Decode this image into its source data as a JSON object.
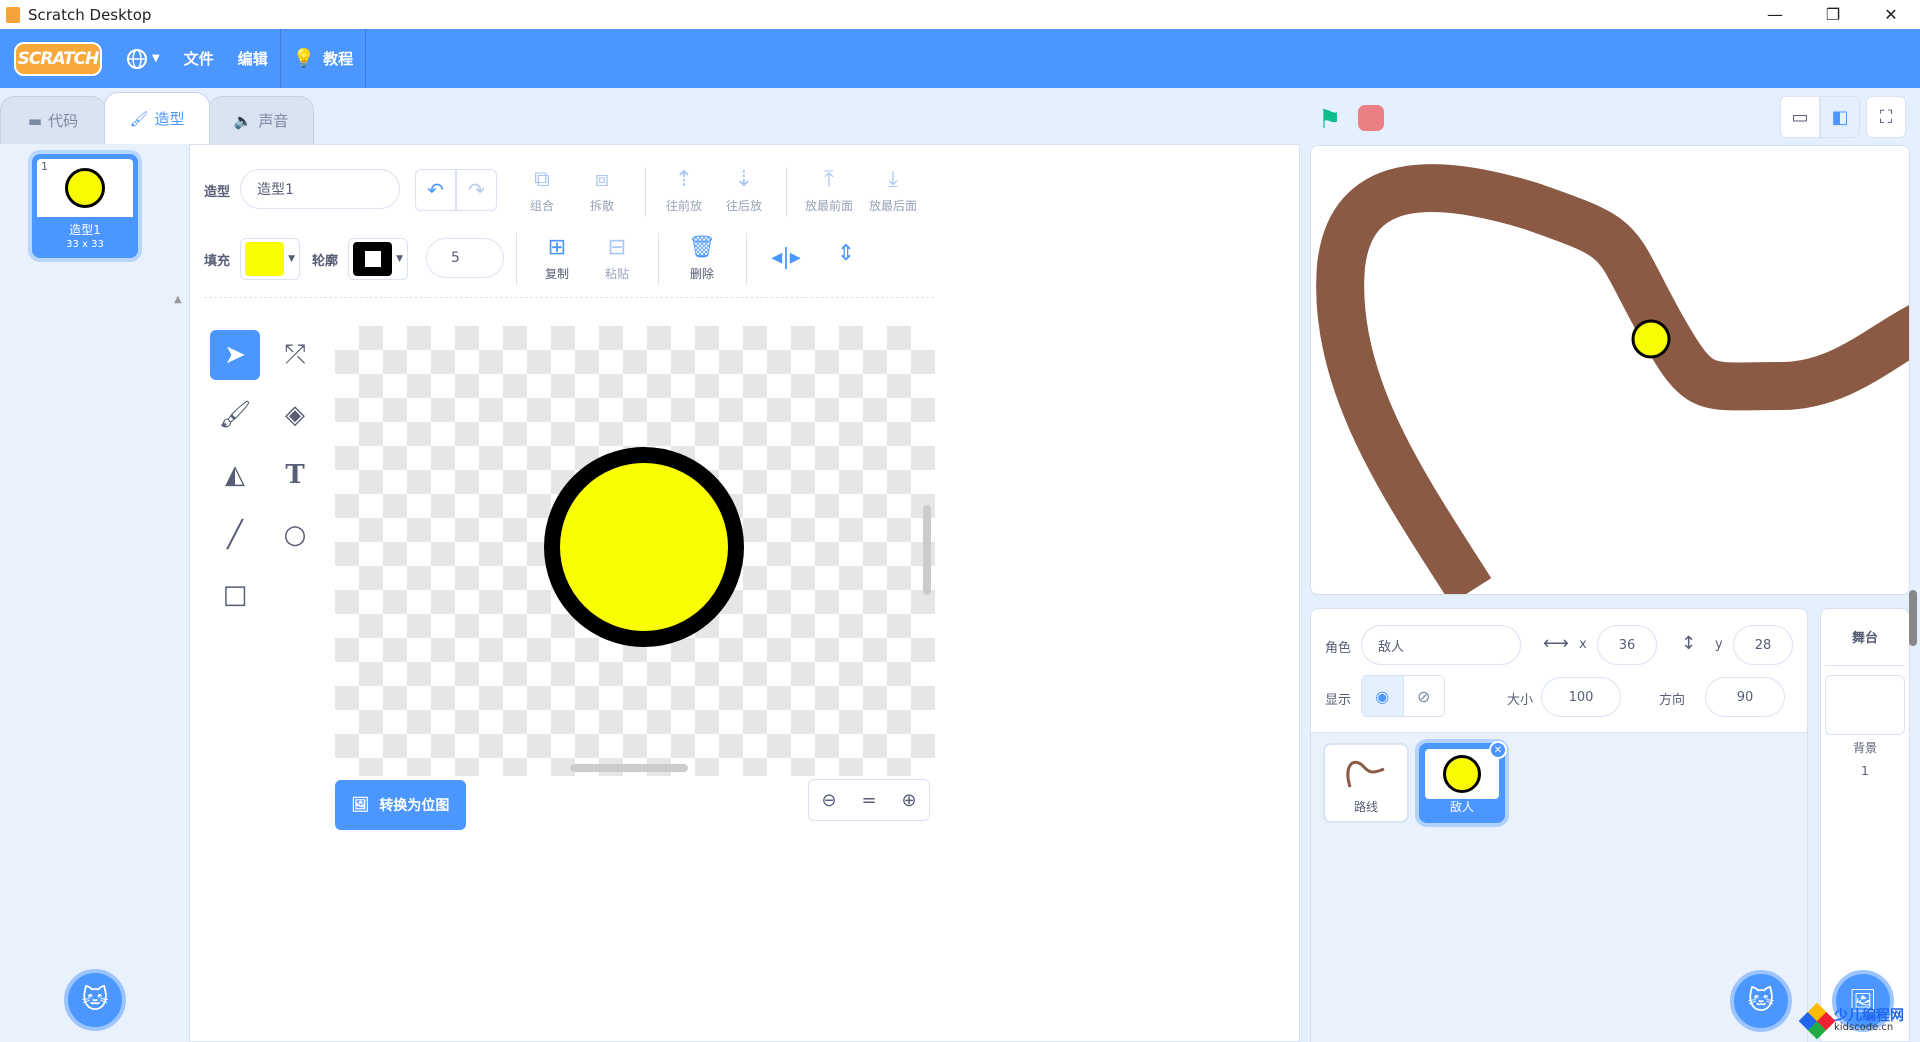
{
  "window": {
    "title": "Scratch Desktop",
    "minimize": "—",
    "restore": "❐",
    "close": "✕"
  },
  "menubar": {
    "logo": "SCRATCH",
    "language_icon": "globe-icon",
    "file": "文件",
    "edit": "编辑",
    "tutorials": "教程"
  },
  "tabs": [
    {
      "label": "代码",
      "icon": "code-icon"
    },
    {
      "label": "造型",
      "icon": "brush-icon"
    },
    {
      "label": "声音",
      "icon": "speaker-icon"
    }
  ],
  "costume_list": {
    "items": [
      {
        "number": "1",
        "name": "造型1",
        "size": "33 x 33"
      }
    ]
  },
  "paint_editor": {
    "costume_label": "造型",
    "costume_name": "造型1",
    "group": "组合",
    "ungroup": "拆散",
    "forward": "往前放",
    "backward": "往后放",
    "front": "放最前面",
    "back": "放最后面",
    "fill_label": "填充",
    "fill_color": "#f9ff00",
    "outline_label": "轮廓",
    "outline_color": "#000000",
    "outline_width": "5",
    "copy": "复制",
    "paste": "粘贴",
    "delete": "删除",
    "convert": "转换为位图",
    "zoom_reset": "="
  },
  "stage": {
    "path_color": "#8a5a44"
  },
  "sprite_info": {
    "sprite_label": "角色",
    "sprite_name": "敌人",
    "x_label": "x",
    "x_value": "36",
    "y_label": "y",
    "y_value": "28",
    "show_label": "显示",
    "size_label": "大小",
    "size_value": "100",
    "direction_label": "方向",
    "direction_value": "90"
  },
  "sprites": [
    {
      "name": "路线",
      "selected": false
    },
    {
      "name": "敌人",
      "selected": true
    }
  ],
  "stage_pane": {
    "header": "舞台",
    "backdrop_label": "背景",
    "backdrop_count": "1"
  },
  "watermark": {
    "cn": "少儿编程网",
    "en": "kidscode.cn"
  }
}
